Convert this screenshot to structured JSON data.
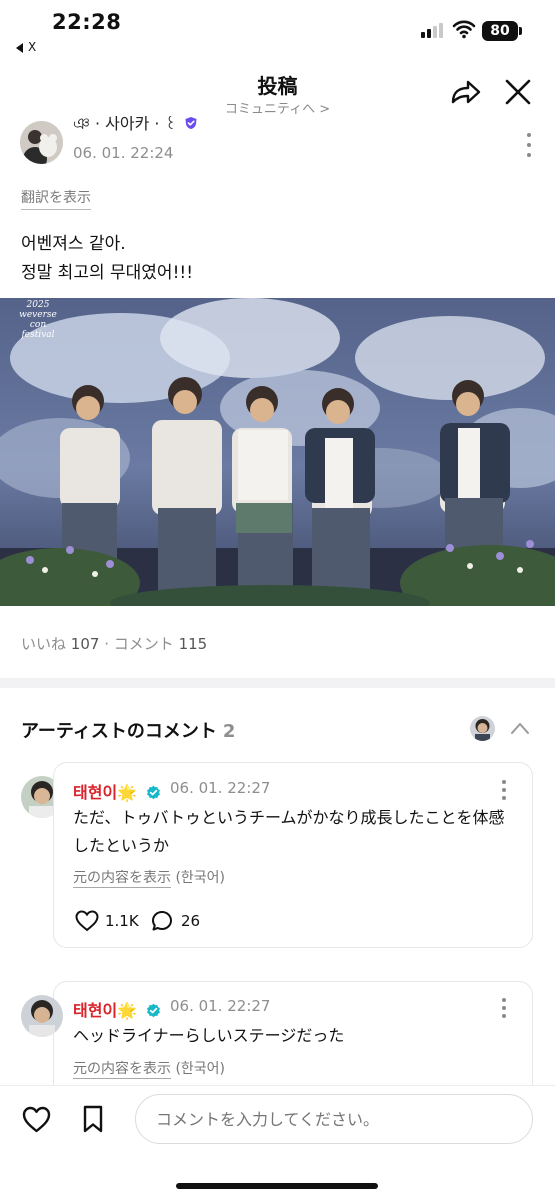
{
  "status_bar": {
    "time": "22:28",
    "back_app": "X",
    "battery": "80"
  },
  "header": {
    "title": "投稿",
    "subtitle": "コミュニティへ >"
  },
  "post": {
    "author_name": "ঞ · 사아카 · ꒰ ",
    "timestamp": "06. 01. 22:24",
    "translate_label": "翻訳を表示",
    "text_line1": "어벤져스 같아.",
    "text_line2": "정말 최고의 무대였어!!!",
    "photo_overlay_text": "2025 weverse con festival",
    "likes_label": "いいね",
    "likes_count": "107",
    "separator": "·",
    "comments_label": "コメント",
    "comments_count": "115"
  },
  "artist_comments": {
    "title": "アーティストのコメント",
    "count": "2",
    "items": [
      {
        "name": "태현이",
        "emoji": "🌟",
        "time": "06. 01. 22:27",
        "text": "ただ、トゥバトゥというチームがかなり成長したことを体感したというか",
        "show_original": "元の内容を表示",
        "original_lang": "(한국어)",
        "likes": "1.1K",
        "replies": "26"
      },
      {
        "name": "태현이",
        "emoji": "🌟",
        "time": "06. 01. 22:27",
        "text": "ヘッドライナーらしいステージだった",
        "show_original": "元の内容を表示",
        "original_lang": "(한국어)"
      }
    ]
  },
  "bottom_bar": {
    "comment_placeholder": "コメントを入力してください。"
  },
  "colors": {
    "artist_name": "#d8232a",
    "verified_badge": "#14b8c9",
    "shield_badge": "#6a4cf0"
  },
  "icons": [
    "share-icon",
    "close-icon",
    "more-vertical-icon",
    "verified-icon",
    "chevron-up-icon",
    "heart-icon",
    "chat-bubble-icon",
    "bookmark-icon",
    "wifi-icon",
    "signal-icon",
    "battery-icon"
  ]
}
